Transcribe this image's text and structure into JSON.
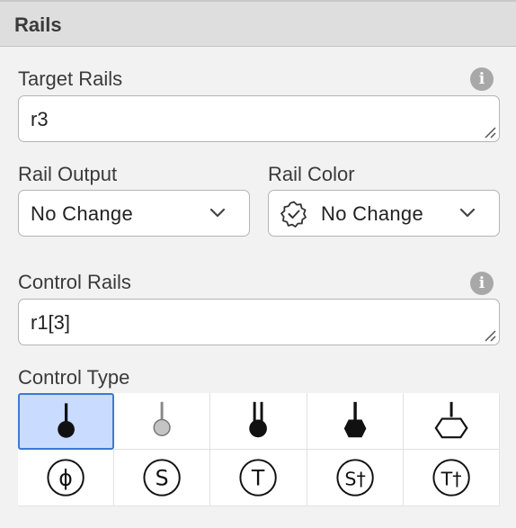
{
  "panel": {
    "title": "Rails"
  },
  "target_rails": {
    "label": "Target Rails",
    "value": "r3",
    "info_icon": "info-icon"
  },
  "rail_output": {
    "label": "Rail Output",
    "value": "No Change"
  },
  "rail_color": {
    "label": "Rail Color",
    "value": "No Change",
    "icon": "badge-outline-icon"
  },
  "control_rails": {
    "label": "Control Rails",
    "value": "r1[3]",
    "info_icon": "info-icon"
  },
  "control_type": {
    "label": "Control Type",
    "options": [
      {
        "name": "filled-dot-control-icon",
        "selected": true
      },
      {
        "name": "gray-dot-control-icon",
        "selected": false
      },
      {
        "name": "double-line-dot-control-icon",
        "selected": false
      },
      {
        "name": "hexagon-filled-control-icon",
        "selected": false
      },
      {
        "name": "hexagon-outline-control-icon",
        "selected": false
      },
      {
        "name": "phi-circle-icon",
        "text": "ϕ",
        "selected": false
      },
      {
        "name": "s-circle-icon",
        "text": "S",
        "selected": false
      },
      {
        "name": "t-circle-icon",
        "text": "T",
        "selected": false
      },
      {
        "name": "s-dagger-circle-icon",
        "text": "S†",
        "selected": false
      },
      {
        "name": "t-dagger-circle-icon",
        "text": "T†",
        "selected": false
      }
    ]
  },
  "colors": {
    "selected_bg": "#c9dcff",
    "selected_border": "#3a7bd5",
    "header_bg": "#dedede"
  }
}
